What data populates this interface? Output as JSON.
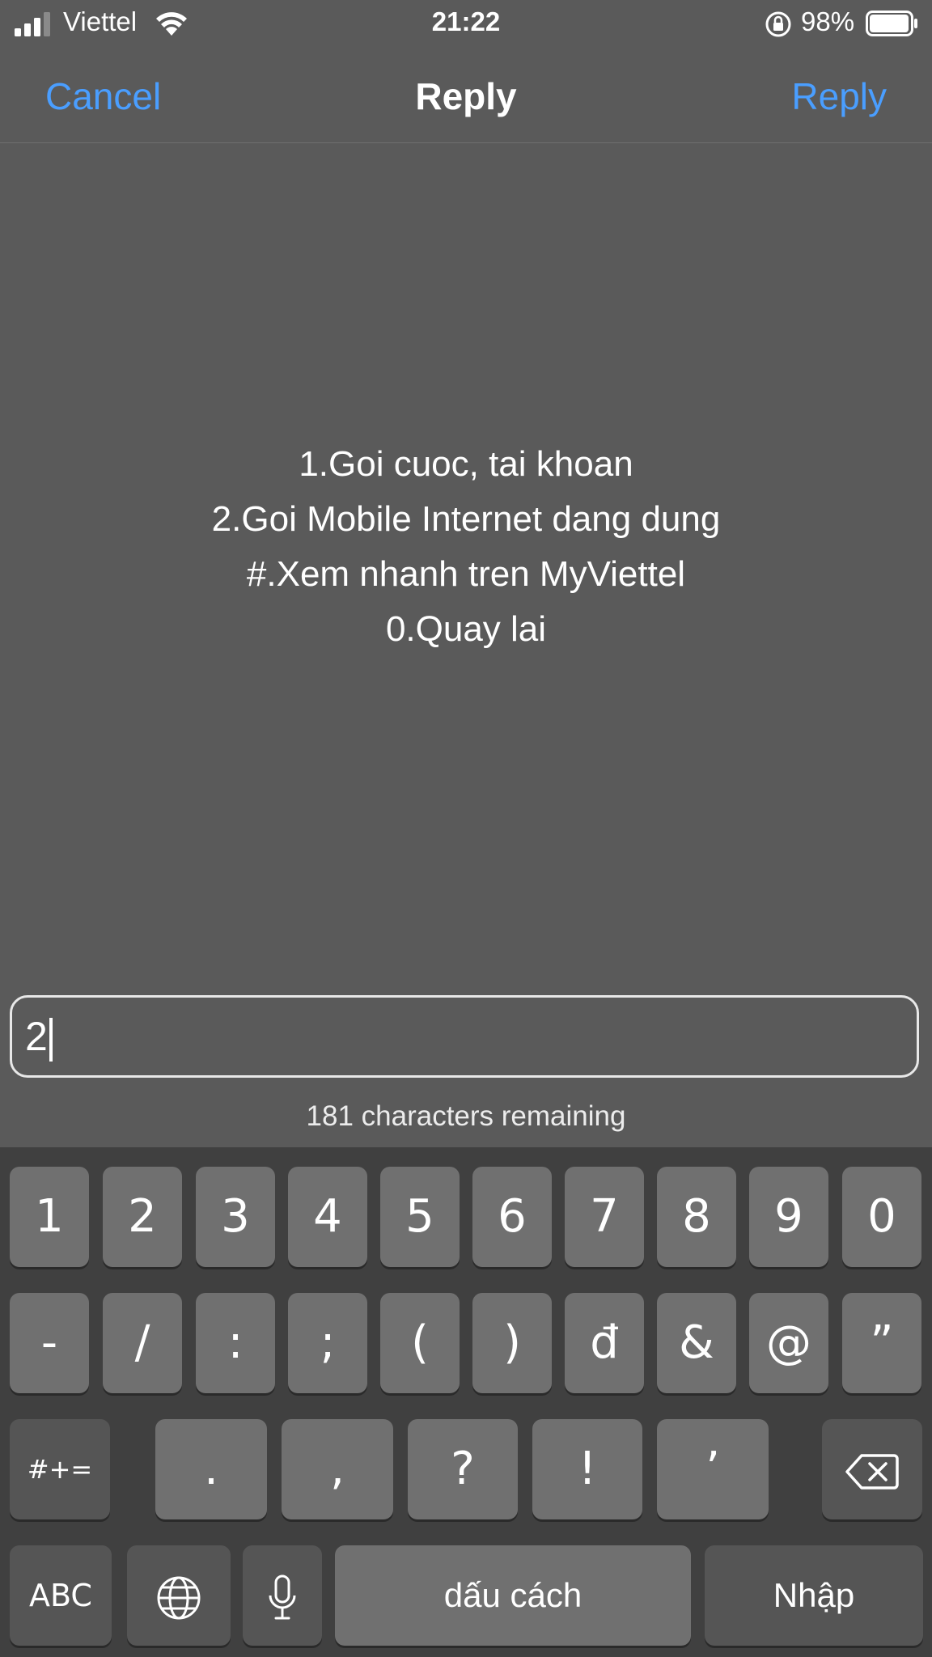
{
  "status": {
    "carrier": "Viettel",
    "time": "21:22",
    "battery_percent": "98%",
    "battery_level": 0.98,
    "icons": [
      "signal-icon",
      "wifi-icon",
      "rotation-lock-icon",
      "battery-icon"
    ]
  },
  "nav": {
    "cancel": "Cancel",
    "title": "Reply",
    "reply": "Reply",
    "accent_color": "#4a9eff"
  },
  "message": {
    "lines": [
      "1.Goi cuoc, tai khoan",
      "2.Goi Mobile Internet dang dung",
      "#.Xem nhanh tren MyViettel",
      "0.Quay lai"
    ]
  },
  "input": {
    "value": "2",
    "remaining": "181 characters remaining"
  },
  "keyboard": {
    "row1": [
      "1",
      "2",
      "3",
      "4",
      "5",
      "6",
      "7",
      "8",
      "9",
      "0"
    ],
    "row2": [
      "-",
      "/",
      ":",
      ";",
      "(",
      ")",
      "đ",
      "&",
      "@",
      "”"
    ],
    "row3": {
      "symbols": "#+=",
      "keys": [
        ".",
        ",",
        "?",
        "!",
        "’"
      ],
      "delete_icon": "backspace-icon"
    },
    "row4": {
      "abc": "ABC",
      "globe_icon": "globe-icon",
      "mic_icon": "microphone-icon",
      "space": "dấu cách",
      "return": "Nhập"
    }
  }
}
